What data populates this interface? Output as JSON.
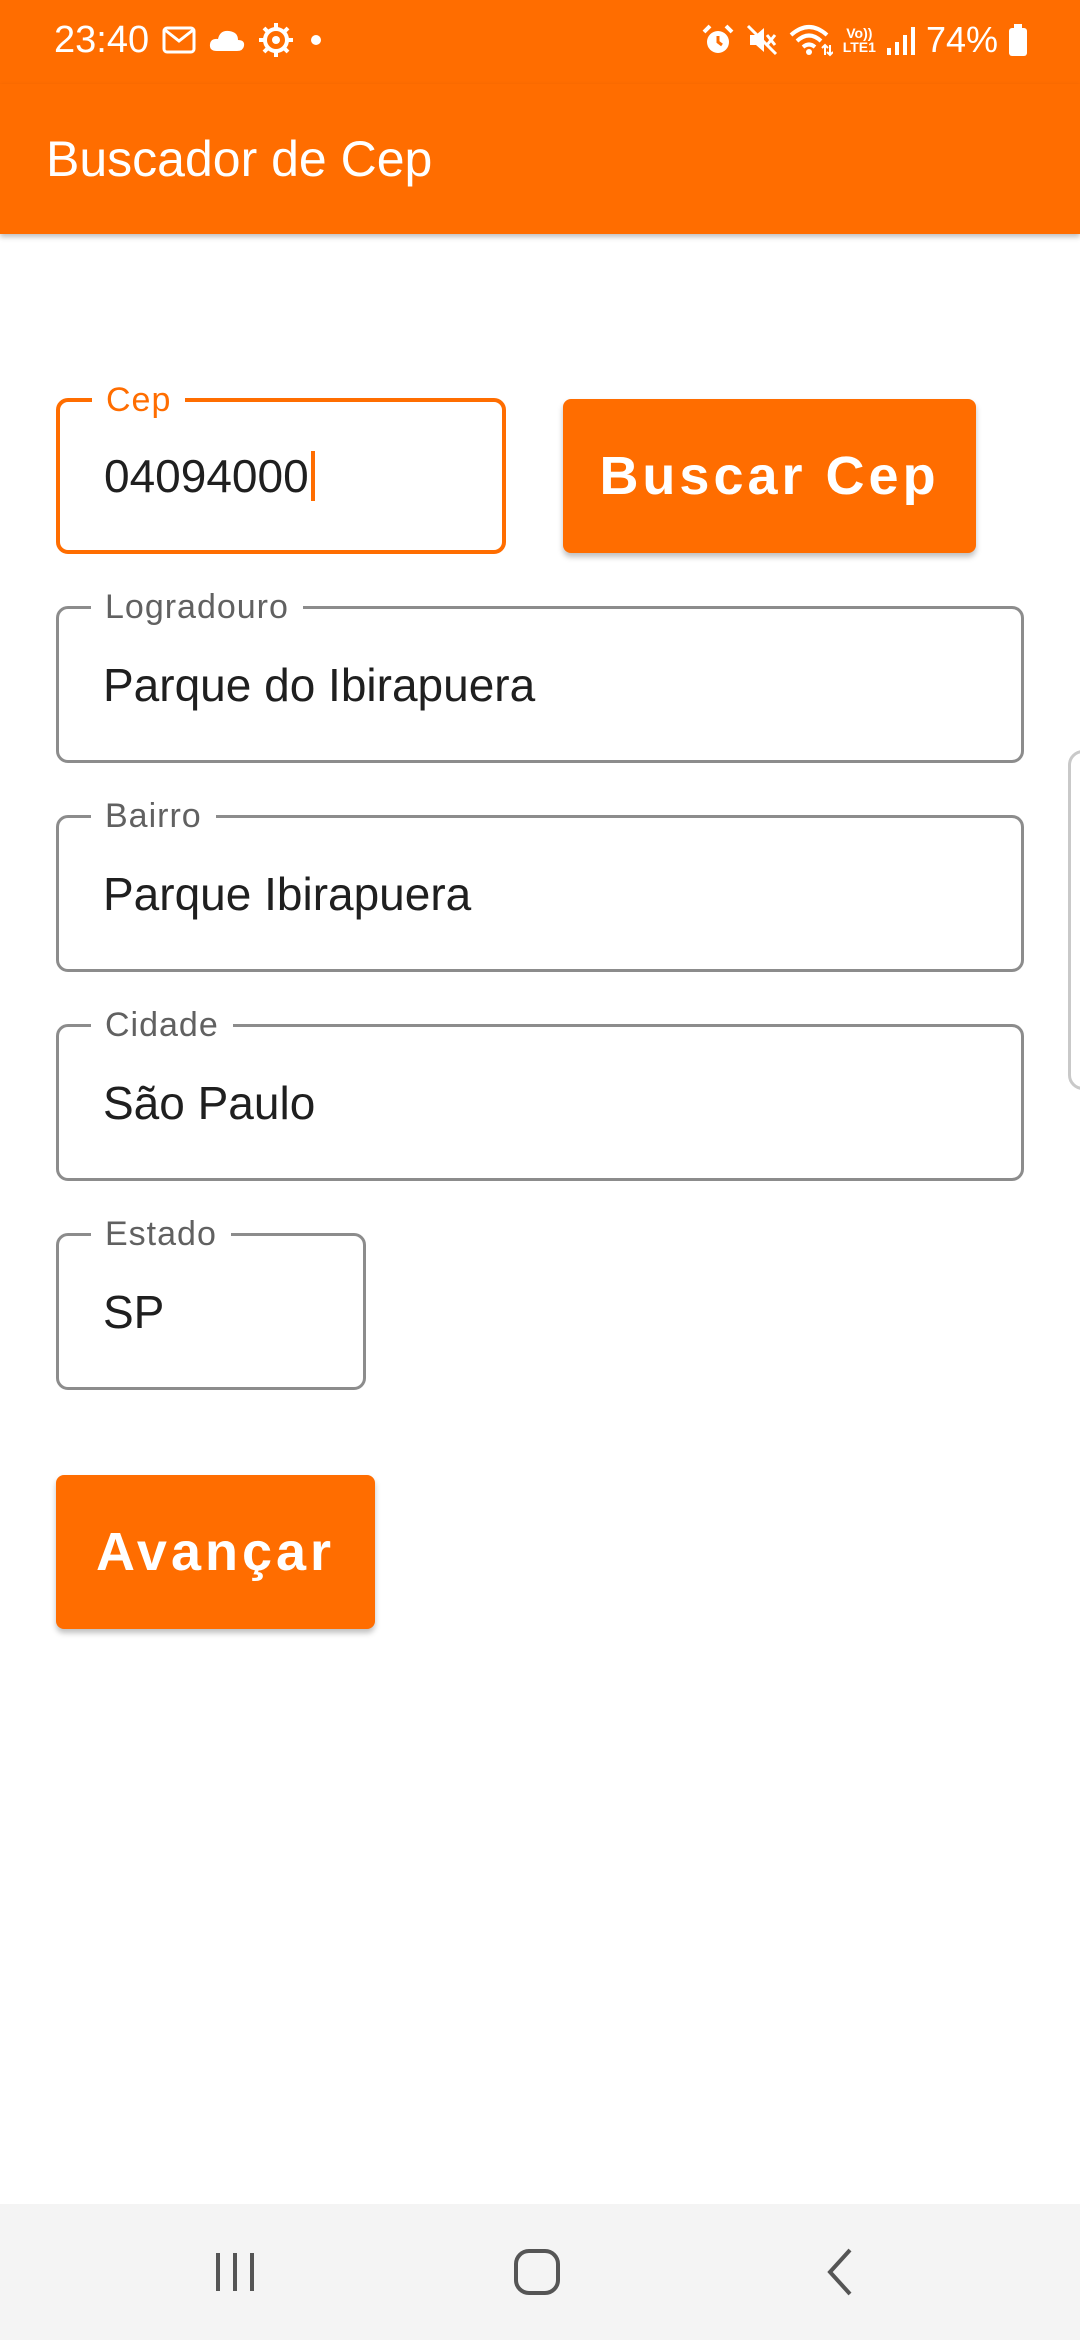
{
  "status_bar": {
    "time": "23:40",
    "battery": "74%",
    "left_icons": [
      "mail-icon",
      "cloud-icon",
      "settings-icon",
      "dot-icon"
    ],
    "right_icons": [
      "alarm-icon",
      "mute-icon",
      "wifi-icon",
      "volte-icon",
      "signal-icon",
      "battery-icon"
    ],
    "volte_label": "Vo))",
    "lte_label": "LTE1"
  },
  "app_bar": {
    "title": "Buscador de Cep",
    "color": "#ff6d00"
  },
  "form": {
    "cep": {
      "label": "Cep",
      "value": "04094000"
    },
    "search_button": "Buscar Cep",
    "logradouro": {
      "label": "Logradouro",
      "value": "Parque do Ibirapuera"
    },
    "bairro": {
      "label": "Bairro",
      "value": "Parque Ibirapuera"
    },
    "cidade": {
      "label": "Cidade",
      "value": "São Paulo"
    },
    "estado": {
      "label": "Estado",
      "value": "SP"
    },
    "next_button": "Avançar"
  },
  "nav_bar": {
    "buttons": [
      "recents-icon",
      "home-icon",
      "back-icon"
    ]
  },
  "colors": {
    "accent": "#ff6d00",
    "outline": "#8c8c8c",
    "nav_background": "#f4f4f4"
  }
}
